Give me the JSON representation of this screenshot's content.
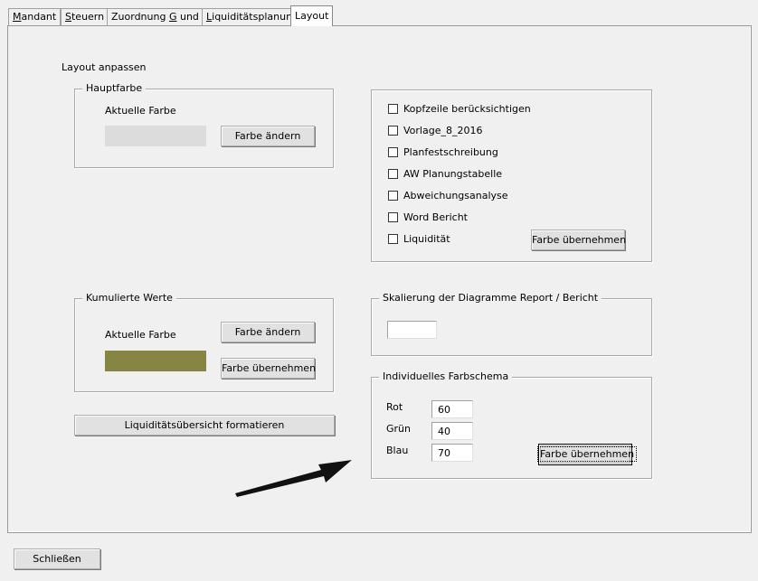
{
  "tabs": [
    {
      "pre": "",
      "key": "M",
      "post": "andant"
    },
    {
      "pre": "",
      "key": "S",
      "post": "teuern"
    },
    {
      "pre": "Zuordnung ",
      "key": "G",
      "post": " und V"
    },
    {
      "pre": "",
      "key": "L",
      "post": "iquiditätsplanung"
    },
    {
      "pre": "Layout",
      "key": "",
      "post": ""
    }
  ],
  "section_title": "Layout anpassen",
  "hauptfarbe": {
    "legend": "Hauptfarbe",
    "current_label": "Aktuelle Farbe",
    "swatch_color": "#dcdcdc",
    "change_button": "Farbe ändern"
  },
  "kumulierte": {
    "legend": "Kumulierte Werte",
    "current_label": "Aktuelle Farbe",
    "swatch_color": "#878543",
    "change_button": "Farbe ändern",
    "apply_button": "Farbe übernehmen"
  },
  "liquid_button": "Liquiditätsübersicht formatieren",
  "checkboxes": [
    {
      "label": "Kopfzeile berücksichtigen",
      "checked": false
    },
    {
      "label": "Vorlage_8_2016",
      "checked": false
    },
    {
      "label": "Planfestschreibung",
      "checked": false
    },
    {
      "label": "AW Planungstabelle",
      "checked": false
    },
    {
      "label": "Abweichungsanalyse",
      "checked": false
    },
    {
      "label": "Word Bericht",
      "checked": false
    },
    {
      "label": "Liquidität",
      "checked": false
    }
  ],
  "checkbox_apply_button": "Farbe übernehmen",
  "skalierung": {
    "legend": "Skalierung der Diagramme Report / Bericht",
    "value": ""
  },
  "farbschema": {
    "legend": "Individuelles Farbschema",
    "rot_label": "Rot",
    "rot_value": "60",
    "gruen_label": "Grün",
    "gruen_value": "40",
    "blau_label": "Blau",
    "blau_value": "70",
    "apply_button": "Farbe übernehmen"
  },
  "close_button": "Schließen",
  "icons": {
    "arrow": "arrow-annotation-icon"
  }
}
